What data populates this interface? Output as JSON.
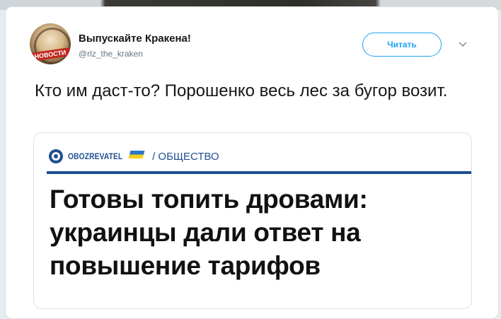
{
  "tweet": {
    "display_name": "Выпускайте Кракена!",
    "handle": "@rlz_the_kraken",
    "avatar_badge": "НОВОСТИ",
    "follow_label": "Читать",
    "text": "Кто им даст-то? Порошенко весь лес за бугор возит."
  },
  "media": {
    "logo_text": "OBOZREVATEL",
    "logo_flag_text": "UA",
    "section": "/ ОБЩЕСТВО",
    "headline": "Готовы топить дровами: украинцы дали ответ на повышение тарифов"
  },
  "icons": {
    "caret": "chevron-down-icon",
    "logo": "obozrevatel-logo-icon"
  },
  "colors": {
    "accent": "#1da1f2",
    "brand": "#1f4f8f",
    "text": "#14171a",
    "muted": "#657786"
  }
}
